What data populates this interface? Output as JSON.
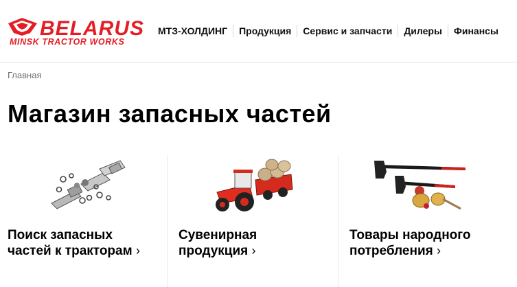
{
  "logo": {
    "brand": "BELARUS",
    "tagline": "MINSK TRACTOR WORKS",
    "color": "#e31e24"
  },
  "nav": {
    "items": [
      {
        "label": "МТЗ-ХОЛДИНГ"
      },
      {
        "label": "Продукция"
      },
      {
        "label": "Сервис и запчасти"
      },
      {
        "label": "Дилеры"
      },
      {
        "label": "Финансы"
      }
    ]
  },
  "breadcrumb": {
    "home": "Главная"
  },
  "page": {
    "title": "Магазин запасных частей"
  },
  "cards": [
    {
      "title": "Поиск запасных частей к тракторам",
      "chevron": "›",
      "image": "spare-parts-image"
    },
    {
      "title": "Сувенирная продукция",
      "chevron": "›",
      "image": "souvenir-tractor-image"
    },
    {
      "title": "Товары народного потребления",
      "chevron": "›",
      "image": "consumer-goods-axes-image"
    }
  ]
}
